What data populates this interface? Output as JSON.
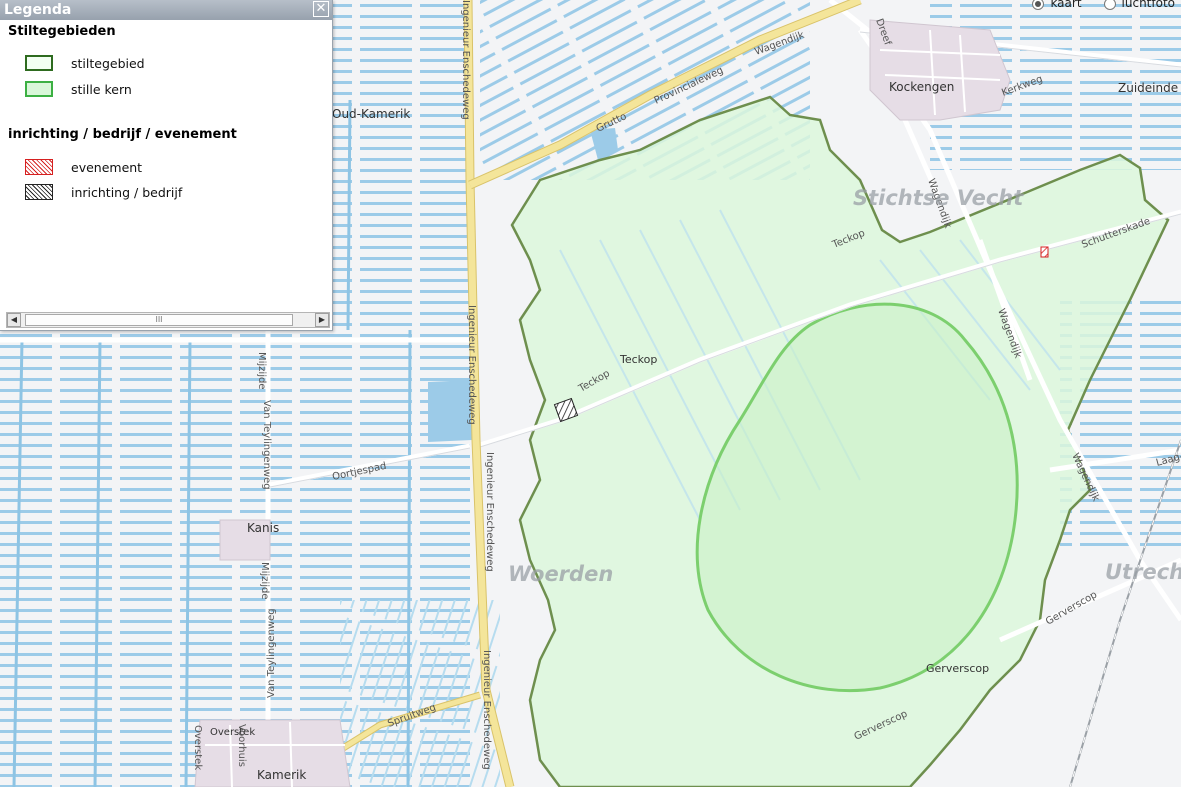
{
  "legend": {
    "title": "Legenda",
    "sections": [
      {
        "heading": "Stiltegebieden",
        "items": [
          {
            "label": "stiltegebied",
            "fill": "#f2fff2",
            "border": "#2e6b1f",
            "pattern": "solid"
          },
          {
            "label": "stille kern",
            "fill": "#d9f7d9",
            "border": "#3cb043",
            "pattern": "solid"
          }
        ]
      },
      {
        "heading": "inrichting / bedrijf / evenement",
        "items": [
          {
            "label": "evenement",
            "fill": "#ffffff",
            "border": "#d62020",
            "pattern": "hatch-red"
          },
          {
            "label": "inrichting / bedrijf",
            "fill": "#ffffff",
            "border": "#222222",
            "pattern": "hatch-black"
          }
        ]
      }
    ],
    "scrollbar_thumb": "III"
  },
  "layer_switch": {
    "options": [
      {
        "label": "kaart",
        "selected": true
      },
      {
        "label": "luchtfoto",
        "selected": false
      }
    ]
  },
  "map": {
    "roads": {
      "provincialeweg": "Provincialeweg",
      "wagendijk_n": "Wagendijk",
      "grutto": "Grutto",
      "dreef": "Dreef",
      "kerkweg": "Kerkweg",
      "ing_ensch_1": "Ingenieur Enschedeweg",
      "ing_ensch_2": "Ingenieur Enschedeweg",
      "ing_ensch_3": "Ingenieur Enschedeweg",
      "ing_ensch_4": "Ingenieur Enschedeweg",
      "teckop_1": "Teckop",
      "teckop_2": "Teckop",
      "teckop_3": "Teckop",
      "schutterskade": "Schutterskade",
      "wagendijk_s": "Wagendijk",
      "wagendijk_e": "Wagendijk",
      "wagendijk_ne": "Wagendijk",
      "oortjespad": "Oortjespad",
      "mijzijde_1": "Mijzijde",
      "mijzijde_2": "Mijzijde",
      "van_teylingenweg_1": "Van Teylingenweg",
      "van_teylingenweg_2": "Van Teylingenweg",
      "spruitweg": "Spruitweg",
      "overstek": "Overstek",
      "voorhuis": "Voorhuis",
      "gerverscop_1": "Gerverscop",
      "gerverscop_2": "Gerverscop",
      "laag": "Laag-"
    },
    "places": {
      "kockengen": "Kockengen",
      "zuideinde": "Zuideinde",
      "oud_kamerik": "Oud-Kamerik",
      "kanis": "Kanis",
      "kamerik": "Kamerik",
      "teckop": "Teckop",
      "gerverscop": "Gerverscop",
      "overstek": "Overstek"
    },
    "municipalities": {
      "stichtse_vecht": "Stichtse Vecht",
      "woerden": "Woerden",
      "utrecht": "Utrech"
    },
    "colors": {
      "background": "#f3f4f6",
      "water": "#9ccbe8",
      "stiltegebied_fill": "#dcf7dc",
      "stiltegebied_border": "#6e8f4e",
      "stille_kern_border": "#7ccf6e",
      "main_road": "#f4e59a"
    }
  }
}
